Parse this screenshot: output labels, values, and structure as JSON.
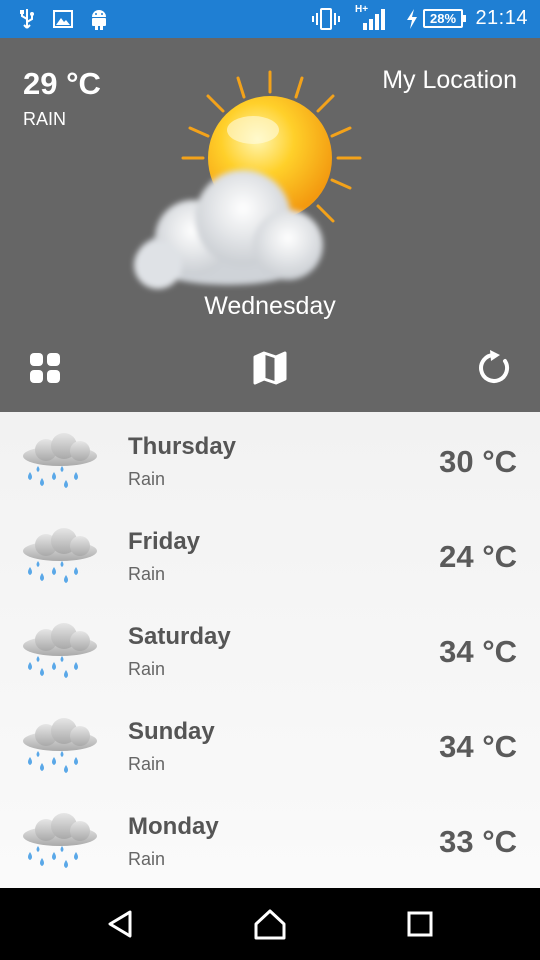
{
  "status_bar": {
    "icons": [
      "usb-icon",
      "image-icon",
      "android-icon",
      "vibrate-icon",
      "signal-icon",
      "charging-icon"
    ],
    "network_label": "H+",
    "battery": "28%",
    "time": "21:14"
  },
  "current": {
    "temperature": "29 °C",
    "condition": "RAIN",
    "location": "My Location",
    "day": "Wednesday",
    "icon": "sun-cloud-icon"
  },
  "actions": {
    "left": "grid-icon",
    "center": "map-icon",
    "right": "refresh-icon"
  },
  "forecast": [
    {
      "day": "Thursday",
      "condition": "Rain",
      "temp": "30 °C",
      "icon": "rain-cloud-icon"
    },
    {
      "day": "Friday",
      "condition": "Rain",
      "temp": "24 °C",
      "icon": "rain-cloud-icon"
    },
    {
      "day": "Saturday",
      "condition": "Rain",
      "temp": "34 °C",
      "icon": "rain-cloud-icon"
    },
    {
      "day": "Sunday",
      "condition": "Rain",
      "temp": "34 °C",
      "icon": "rain-cloud-icon"
    },
    {
      "day": "Monday",
      "condition": "Rain",
      "temp": "33 °C",
      "icon": "rain-cloud-icon"
    }
  ],
  "nav": [
    "back-icon",
    "home-icon",
    "recents-icon"
  ],
  "colors": {
    "status_bar": "#1f7fd3",
    "header": "#666666",
    "text_dark": "#5a5a5a"
  }
}
